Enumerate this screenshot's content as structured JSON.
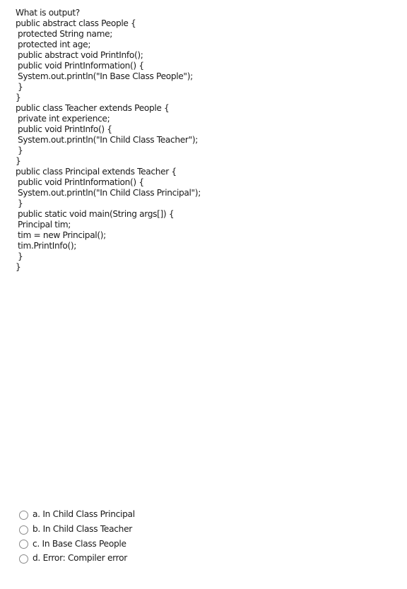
{
  "question": {
    "prompt": "What is output?",
    "code_lines": [
      {
        "text": "public abstract class People {",
        "indent": false
      },
      {
        "text": "protected String name;",
        "indent": true
      },
      {
        "text": "protected int age;",
        "indent": true
      },
      {
        "text": "public abstract void PrintInfo();",
        "indent": true
      },
      {
        "text": "public void PrintInformation() {",
        "indent": true
      },
      {
        "text": "System.out.println(\"In Base Class People\");",
        "indent": true
      },
      {
        "text": "}",
        "indent": true
      },
      {
        "text": "}",
        "indent": false
      },
      {
        "text": "public class Teacher extends People {",
        "indent": false
      },
      {
        "text": "private int experience;",
        "indent": true
      },
      {
        "text": "public void PrintInfo() {",
        "indent": true
      },
      {
        "text": "System.out.println(\"In Child Class Teacher\");",
        "indent": true
      },
      {
        "text": "}",
        "indent": true
      },
      {
        "text": "}",
        "indent": false
      },
      {
        "text": "public class Principal extends Teacher {",
        "indent": false
      },
      {
        "text": "public void PrintInformation() {",
        "indent": true
      },
      {
        "text": "System.out.println(\"In Child Class Principal\");",
        "indent": true
      },
      {
        "text": "}",
        "indent": true
      },
      {
        "text": "public static void main(String args[]) {",
        "indent": true
      },
      {
        "text": "Principal tim;",
        "indent": true
      },
      {
        "text": "tim = new Principal();",
        "indent": true
      },
      {
        "text": "tim.PrintInfo();",
        "indent": true
      },
      {
        "text": "}",
        "indent": true
      },
      {
        "text": "}",
        "indent": false
      }
    ]
  },
  "options": [
    {
      "letter": "a.",
      "label": "a. In Child Class Principal",
      "selected": false
    },
    {
      "letter": "b.",
      "label": "b. In Child Class Teacher",
      "selected": false
    },
    {
      "letter": "c.",
      "label": "c. In Base Class People",
      "selected": false
    },
    {
      "letter": "d.",
      "label": "d. Error: Compiler error",
      "selected": false
    }
  ]
}
